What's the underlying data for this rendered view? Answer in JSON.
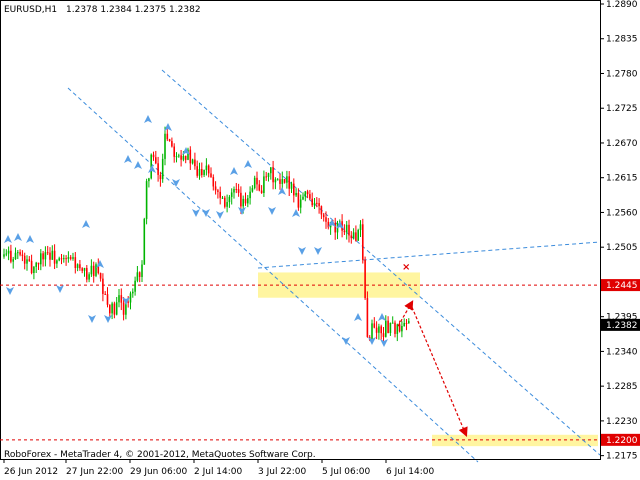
{
  "header": {
    "symbol": "EURUSD,H1",
    "ohlc": "1.2378 1.2384 1.2375 1.2382"
  },
  "footer": {
    "copyright": "RoboForex - MetaTrader 4, © 2001-2012, MetaQuotes Software Corp."
  },
  "colors": {
    "background": "#ffffff",
    "candle_up": "#00b400",
    "candle_down": "#ff0000",
    "doji": "#606060",
    "channel": "#3c8cdc",
    "fractal": "#5aa0e6",
    "level_line": "#e00000",
    "highlight_zone": "#fff5a0",
    "forecast_arrow": "#e00000",
    "price_label_bg": "#e00000",
    "current_price_bg": "#000000",
    "label_text": "#ffffff"
  },
  "chart_data": {
    "type": "candlestick",
    "symbol": "EURUSD",
    "timeframe": "H1",
    "ylim": [
      1.2176,
      1.289
    ],
    "y_ticks": [
      "1.2890",
      "1.2835",
      "1.2780",
      "1.2725",
      "1.2670",
      "1.2615",
      "1.2560",
      "1.2505",
      "1.2445",
      "1.2395",
      "1.2340",
      "1.2285",
      "1.2230",
      "1.2175"
    ],
    "x_ticks": [
      "26 Jun 2012",
      "27 Jun 22:00",
      "29 Jun 06:00",
      "2 Jul 14:00",
      "3 Jul 22:00",
      "5 Jul 06:00",
      "6 Jul 14:00"
    ],
    "grid": false,
    "candles_start_index": 0,
    "price_path": [
      [
        0,
        1.249
      ],
      [
        6,
        1.2495
      ],
      [
        12,
        1.247
      ],
      [
        18,
        1.25
      ],
      [
        24,
        1.248
      ],
      [
        30,
        1.2485
      ],
      [
        34,
        1.246
      ],
      [
        40,
        1.247
      ],
      [
        44,
        1.242
      ],
      [
        48,
        1.24
      ],
      [
        50,
        1.242
      ],
      [
        52,
        1.241
      ],
      [
        56,
        1.243
      ],
      [
        60,
        1.248
      ],
      [
        62,
        1.26
      ],
      [
        64,
        1.265
      ],
      [
        68,
        1.261
      ],
      [
        70,
        1.269
      ],
      [
        74,
        1.266
      ],
      [
        80,
        1.265
      ],
      [
        84,
        1.262
      ],
      [
        88,
        1.264
      ],
      [
        92,
        1.26
      ],
      [
        96,
        1.258
      ],
      [
        100,
        1.259
      ],
      [
        104,
        1.257
      ],
      [
        108,
        1.261
      ],
      [
        112,
        1.26
      ],
      [
        116,
        1.262
      ],
      [
        120,
        1.26
      ],
      [
        124,
        1.261
      ],
      [
        128,
        1.258
      ],
      [
        132,
        1.259
      ],
      [
        136,
        1.257
      ],
      [
        140,
        1.254
      ],
      [
        144,
        1.253
      ],
      [
        148,
        1.254
      ],
      [
        152,
        1.252
      ],
      [
        155,
        1.253
      ],
      [
        157,
        1.242
      ],
      [
        158,
        1.236
      ],
      [
        160,
        1.238
      ],
      [
        164,
        1.237
      ],
      [
        168,
        1.2385
      ],
      [
        172,
        1.237
      ],
      [
        176,
        1.2382
      ]
    ],
    "series": [
      {
        "name": "",
        "kind": "channel",
        "points": [
          [
            1.2755,
            0
          ],
          [
            1.24,
            80
          ]
        ]
      },
      {
        "name": "",
        "kind": "level",
        "value": 1.2445
      },
      {
        "name": "",
        "kind": "level",
        "value": 1.22
      }
    ],
    "price_labels": [
      {
        "value": 1.2445,
        "text": "1.2445",
        "style": "level"
      },
      {
        "value": 1.2382,
        "text": "1.2382",
        "style": "current"
      },
      {
        "value": 1.22,
        "text": "1.2200",
        "style": "level"
      }
    ],
    "zones": [
      {
        "price_low": 1.2425,
        "price_high": 1.2465
      },
      {
        "price_low": 1.219,
        "price_high": 1.2208
      }
    ],
    "forecast": [
      {
        "from": 1.238,
        "to": 1.2418
      },
      {
        "from": 1.241,
        "to": 1.2208
      }
    ],
    "x_mark": {
      "value": 1.2475
    }
  }
}
